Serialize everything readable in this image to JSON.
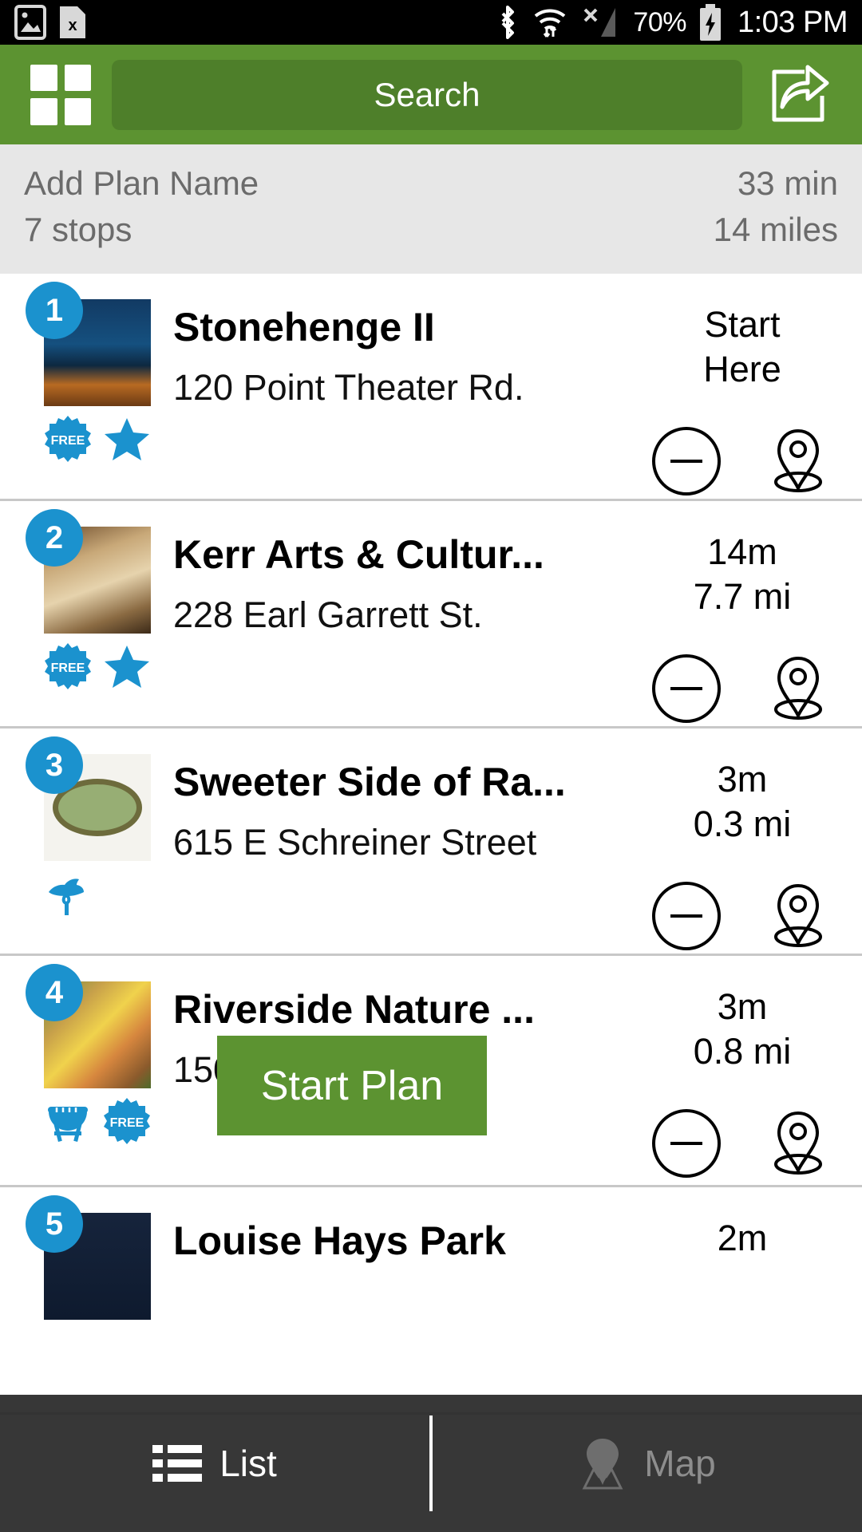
{
  "statusbar": {
    "battery_percent": "70%",
    "time": "1:03 PM",
    "icons": [
      "gallery-icon",
      "sim-card-x-icon",
      "bluetooth-icon",
      "wifi-icon",
      "cellular-x-icon",
      "battery-charging-icon"
    ]
  },
  "appbar": {
    "grid_icon": "grid-menu-icon",
    "search_label": "Search",
    "share_icon": "share-icon",
    "accent_color": "#5c9331"
  },
  "plan": {
    "name": "Add Plan Name",
    "stops": "7 stops",
    "duration": "33 min",
    "distance": "14 miles"
  },
  "stops": [
    {
      "number": "1",
      "title": "Stonehenge II",
      "address": "120 Point Theater Rd.",
      "meta_line1": "Start",
      "meta_line2": "Here",
      "badges": [
        "free-badge-icon",
        "star-icon"
      ],
      "remove_icon": "minus-circle-icon",
      "pin_icon": "map-pin-icon"
    },
    {
      "number": "2",
      "title": "Kerr Arts & Cultur...",
      "address": "228 Earl Garrett St.",
      "meta_line1": "14m",
      "meta_line2": "7.7 mi",
      "badges": [
        "free-badge-icon",
        "star-icon"
      ],
      "remove_icon": "minus-circle-icon",
      "pin_icon": "map-pin-icon"
    },
    {
      "number": "3",
      "title": "Sweeter Side of Ra...",
      "address": "615 E Schreiner Street",
      "meta_line1": "3m",
      "meta_line2": "0.3 mi",
      "badges": [
        "bird-icon"
      ],
      "remove_icon": "minus-circle-icon",
      "pin_icon": "map-pin-icon"
    },
    {
      "number": "4",
      "title": "Riverside Nature ...",
      "address": "150 Stre",
      "meta_line1": "3m",
      "meta_line2": "0.8 mi",
      "badges": [
        "grill-icon",
        "free-badge-icon"
      ],
      "remove_icon": "minus-circle-icon",
      "pin_icon": "map-pin-icon"
    },
    {
      "number": "5",
      "title": "Louise Hays Park",
      "address": "",
      "meta_line1": "2m",
      "meta_line2": "",
      "badges": [],
      "remove_icon": "minus-circle-icon",
      "pin_icon": "map-pin-icon"
    }
  ],
  "start_plan": {
    "label": "Start Plan",
    "color": "#5c9331"
  },
  "bottomnav": {
    "tabs": [
      {
        "label": "List",
        "icon": "list-icon",
        "active": true
      },
      {
        "label": "Map",
        "icon": "map-pin-icon",
        "active": false
      }
    ]
  },
  "colors": {
    "brand_green": "#5c9331",
    "badge_blue": "#1b92ce",
    "plan_bg": "#e7e7e7"
  }
}
